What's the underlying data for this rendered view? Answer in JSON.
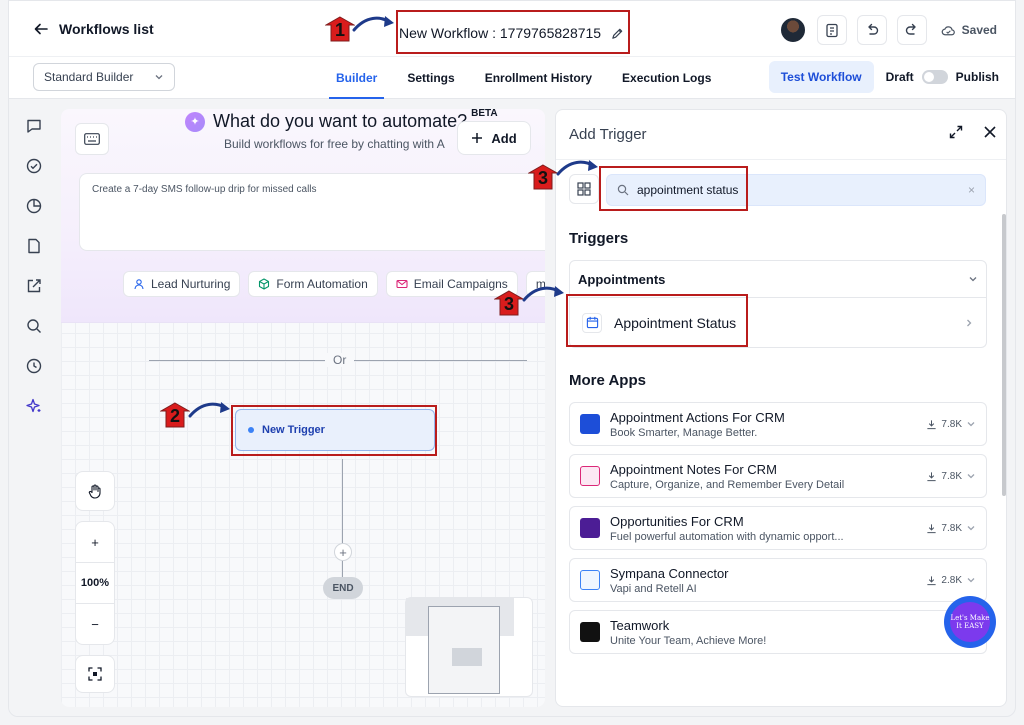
{
  "header": {
    "back_label": "Workflows list",
    "workflow_title": "New Workflow : 1779765828715",
    "saved_label": "Saved"
  },
  "subbar": {
    "builder_mode": "Standard Builder",
    "tabs": [
      "Builder",
      "Settings",
      "Enrollment History",
      "Execution Logs"
    ],
    "active_tab": "Builder",
    "test_label": "Test Workflow",
    "draft_label": "Draft",
    "publish_label": "Publish"
  },
  "rail": {
    "icons": [
      "chat-icon",
      "check-circle-icon",
      "pie-chart-icon",
      "document-icon",
      "external-link-icon",
      "search-icon",
      "history-icon",
      "sparkles-icon"
    ]
  },
  "ai": {
    "title": "What do you want to automate?",
    "beta": "BETA",
    "subtitle": "Build workflows for free by chatting with A",
    "add_label": "Add",
    "prompt": "Create a 7-day SMS follow-up drip for missed calls",
    "chips": [
      "Lead Nurturing",
      "Form Automation",
      "Email Campaigns",
      "mc"
    ]
  },
  "canvas": {
    "or_label": "Or",
    "trigger_label": "New Trigger",
    "end_label": "END",
    "zoom_in": "+",
    "zoom_level": "100%",
    "zoom_out": "−"
  },
  "panel": {
    "title": "Add Trigger",
    "search_value": "appointment status",
    "triggers_heading": "Triggers",
    "group_label": "Appointments",
    "trigger_item": "Appointment Status",
    "more_apps_heading": "More Apps",
    "apps": [
      {
        "name": "Appointment Actions For CRM",
        "desc": "Book Smarter, Manage Better.",
        "downloads": "7.8K",
        "color": "#1d4ed8"
      },
      {
        "name": "Appointment Notes For CRM",
        "desc": "Capture, Organize, and Remember Every Detail",
        "downloads": "7.8K",
        "color": "#db2777"
      },
      {
        "name": "Opportunities For CRM",
        "desc": "Fuel powerful automation with dynamic opport...",
        "downloads": "7.8K",
        "color": "#4c1d95"
      },
      {
        "name": "Sympana Connector",
        "desc": "Vapi and Retell AI",
        "downloads": "2.8K",
        "color": "#3b82f6"
      },
      {
        "name": "Teamwork",
        "desc": "Unite Your Team, Achieve More!",
        "downloads": "",
        "color": "#111111"
      }
    ]
  },
  "badge": {
    "text": "Let's Make It EASY"
  },
  "annotations": {
    "markers": [
      "1",
      "2",
      "3",
      "3"
    ],
    "color": "#b91c1c"
  }
}
